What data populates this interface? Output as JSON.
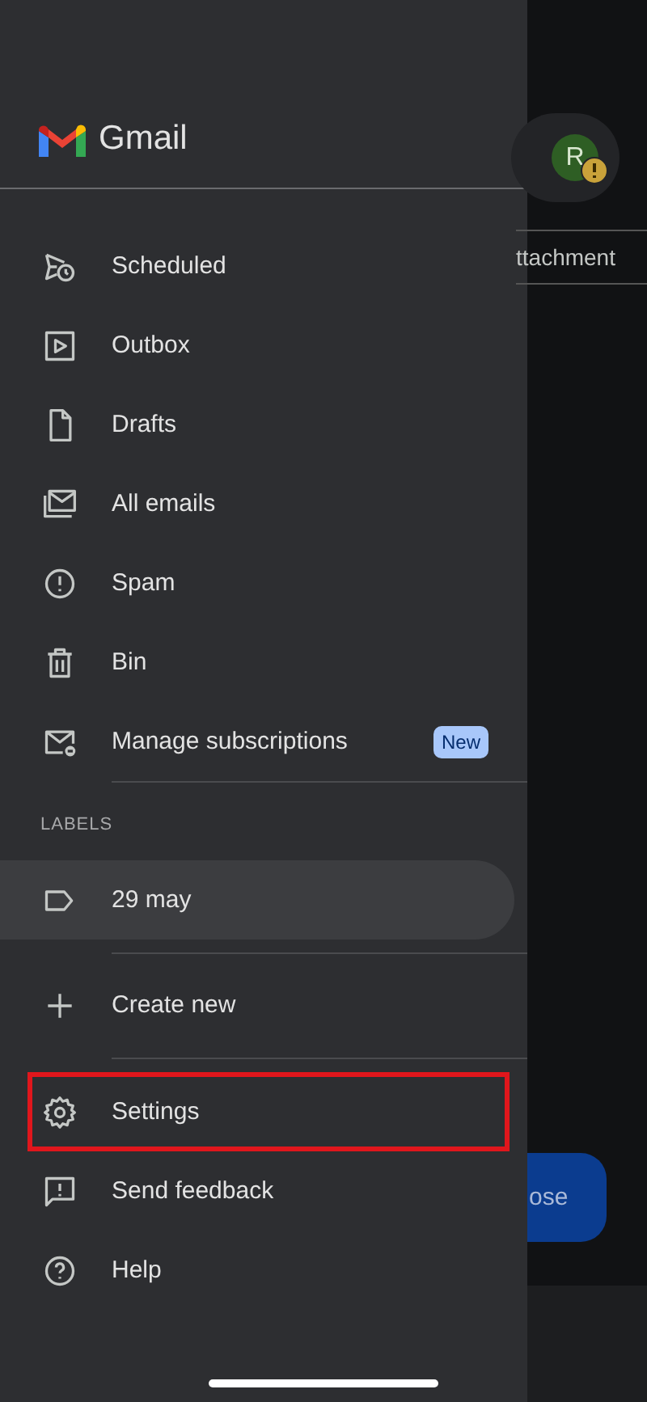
{
  "background": {
    "avatar_letter": "R",
    "tab_label": "ttachment",
    "compose_label": "ose"
  },
  "drawer": {
    "title": "Gmail",
    "mail_items": [
      {
        "label": "Scheduled",
        "selected": false
      },
      {
        "label": "Outbox",
        "selected": false
      },
      {
        "label": "Drafts",
        "selected": false
      },
      {
        "label": "All emails",
        "selected": false
      },
      {
        "label": "Spam",
        "selected": false
      },
      {
        "label": "Bin",
        "selected": false
      },
      {
        "label": "Manage subscriptions",
        "selected": false,
        "badge": "New"
      }
    ],
    "labels_heading": "LABELS",
    "labels": [
      {
        "label": "29 may",
        "selected": true
      }
    ],
    "create_new": "Create new",
    "footer_items": [
      {
        "label": "Settings",
        "highlighted": true
      },
      {
        "label": "Send feedback",
        "highlighted": false
      },
      {
        "label": "Help",
        "highlighted": false
      }
    ]
  }
}
